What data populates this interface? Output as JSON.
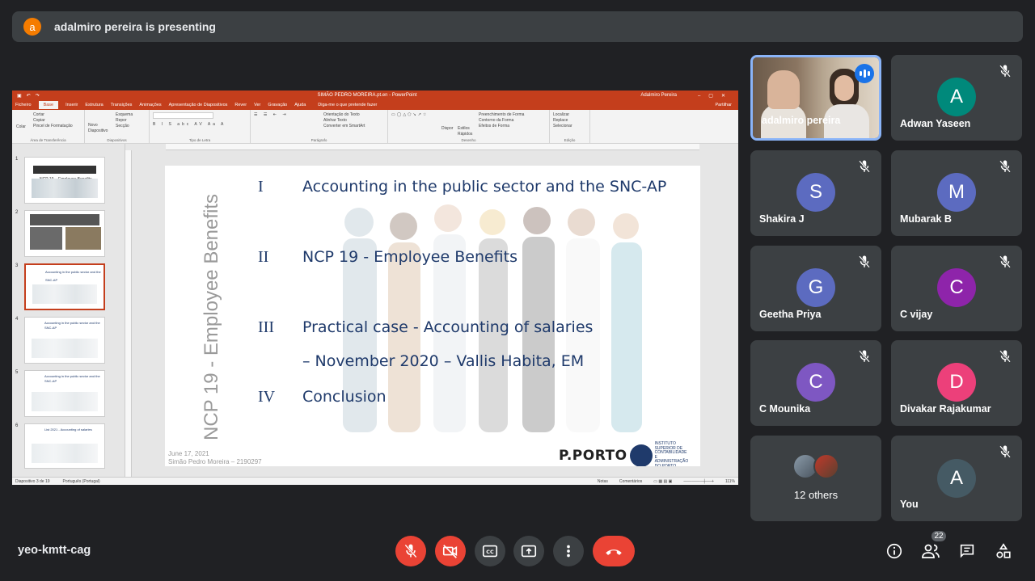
{
  "banner": {
    "avatar_letter": "a",
    "text": "adalmiro pereira is presenting"
  },
  "ppt": {
    "title": "SIMÃO PEDRO MOREIRA.pt.en - PowerPoint",
    "user": "Adalmiro Pereira",
    "tabs": [
      "Ficheiro",
      "Base",
      "Inserir",
      "Estrutura",
      "Transições",
      "Animações",
      "Apresentação de Diapositivos",
      "Rever",
      "Ver",
      "Gravação",
      "Ajuda"
    ],
    "tell_me": "Diga-me o que pretende fazer",
    "share": "Partilhar",
    "ribbon": {
      "clipboard": {
        "paste": "Colar",
        "cut": "Cortar",
        "copy": "Copiar",
        "format": "Pincel de Formatação",
        "label": "Área de Transferência"
      },
      "slides": {
        "new": "Novo Diapositivo",
        "layout": "Esquema",
        "reset": "Repor",
        "section": "Secção",
        "label": "Diapositivos"
      },
      "font": {
        "label": "Tipo de Letra"
      },
      "paragraph": {
        "dir": "Orientação do Texto",
        "align": "Alinhar Texto",
        "smartart": "Converter em SmartArt",
        "label": "Parágrafo"
      },
      "drawing": {
        "arrange": "Dispor",
        "styles": "Estilos Rápidos",
        "fill": "Preenchimento de Forma",
        "outline": "Contorno da Forma",
        "effects": "Efeitos de Forma",
        "label": "Desenho"
      },
      "editing": {
        "find": "Localizar",
        "replace": "Replace",
        "select": "Selecionar",
        "label": "Edição"
      }
    },
    "thumbs": [
      {
        "num": "1",
        "title": "NCP 19 – Employee Benefits"
      },
      {
        "num": "2",
        "title": ""
      },
      {
        "num": "3",
        "title": "Accounting in the public sector and the SNC-AP"
      },
      {
        "num": "4",
        "title": "Accounting in the public sector and the SNC-AP"
      },
      {
        "num": "5",
        "title": "Accounting in the public sector and the SNC-AP"
      },
      {
        "num": "6",
        "title": "List 2021 - Accounting of salaries"
      }
    ],
    "slide": {
      "vertical_title": "NCP 19 - Employee Benefits",
      "items": [
        {
          "num": "I",
          "text": "Accounting in the public sector and the SNC-AP"
        },
        {
          "num": "II",
          "text": "NCP 19 - Employee Benefits"
        },
        {
          "num": "III",
          "text": "Practical case - Accounting of salaries"
        },
        {
          "num": "",
          "text": "– November 2020 – Vallis Habita, EM"
        },
        {
          "num": "IV",
          "text": "Conclusion"
        }
      ],
      "date": "June 17, 2021",
      "author": "Simão Pedro Moreira – 2190297",
      "logo": "P.PORTO",
      "institute": "INSTITUTO SUPERIOR DE CONTABILIDADE E ADMINISTRAÇÃO DO PORTO"
    },
    "status": {
      "slide": "Diapositivo 3 de 19",
      "lang": "Português (Portugal)",
      "notes": "Notas",
      "comments": "Comentários",
      "zoom": "111%"
    }
  },
  "participants": [
    {
      "name": "adalmiro pereira",
      "active": true
    },
    {
      "name": "Adwan Yaseen",
      "letter": "A",
      "color": "#00897b"
    },
    {
      "name": "Shakira J",
      "letter": "S",
      "color": "#5c6bc0"
    },
    {
      "name": "Mubarak B",
      "letter": "M",
      "color": "#5c6bc0"
    },
    {
      "name": "Geetha Priya",
      "letter": "G",
      "color": "#5c6bc0"
    },
    {
      "name": "C vijay",
      "letter": "C",
      "color": "#8e24aa"
    },
    {
      "name": "C Mounika",
      "letter": "C",
      "color": "#7e57c2"
    },
    {
      "name": "Divakar Rajakumar",
      "letter": "D",
      "color": "#ec407a"
    },
    {
      "name": "12 others"
    },
    {
      "name": "You",
      "letter": "A",
      "color": "#455a64"
    }
  ],
  "bottom": {
    "meeting_code": "yeo-kmtt-cag",
    "people_count": "22"
  }
}
